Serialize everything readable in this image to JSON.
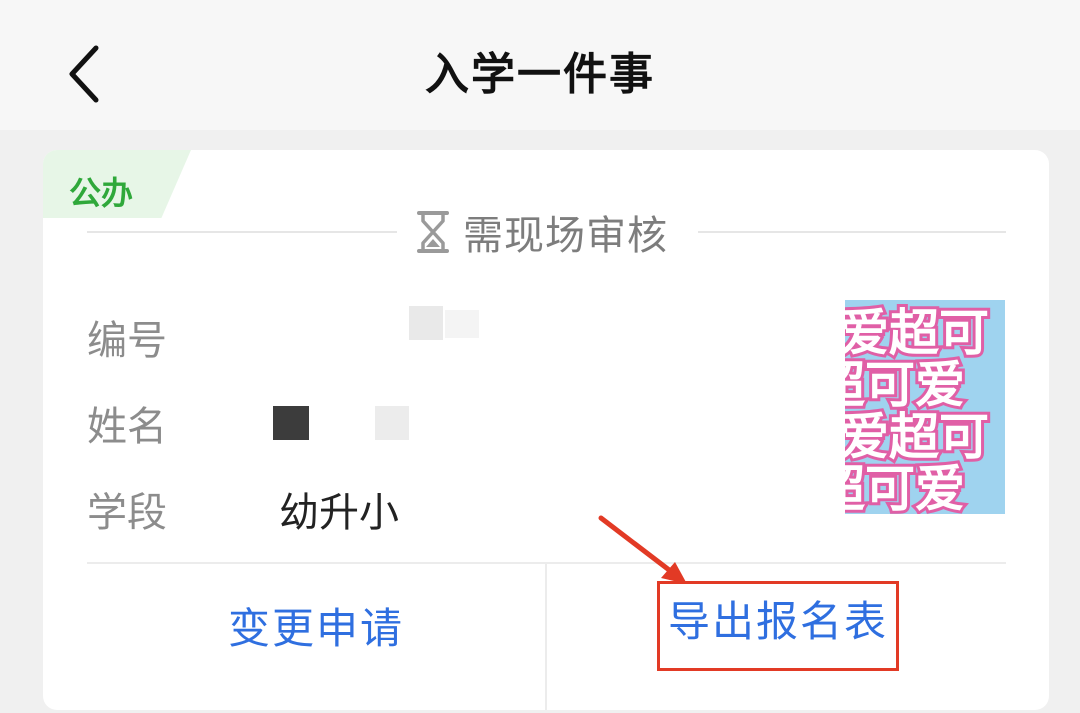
{
  "header": {
    "title": "入学一件事",
    "back_icon": "chevron-left-icon"
  },
  "card": {
    "type_tag": "公办",
    "status": {
      "icon": "hourglass-icon",
      "text": "需现场审核"
    },
    "fields": [
      {
        "label": "编号",
        "value": ""
      },
      {
        "label": "姓名",
        "value": ""
      },
      {
        "label": "学段",
        "value": "幼升小"
      }
    ],
    "photo": {
      "words": [
        "爱超可",
        "超可爱",
        "爱超可",
        "超可爱"
      ]
    },
    "actions": {
      "change_label": "变更申请",
      "export_label": "导出报名表"
    }
  },
  "colors": {
    "accent_blue": "#2f6fe0",
    "tag_green": "#2fa83a",
    "tag_bg": "#e7f6e7",
    "highlight_red": "#e23a25"
  }
}
